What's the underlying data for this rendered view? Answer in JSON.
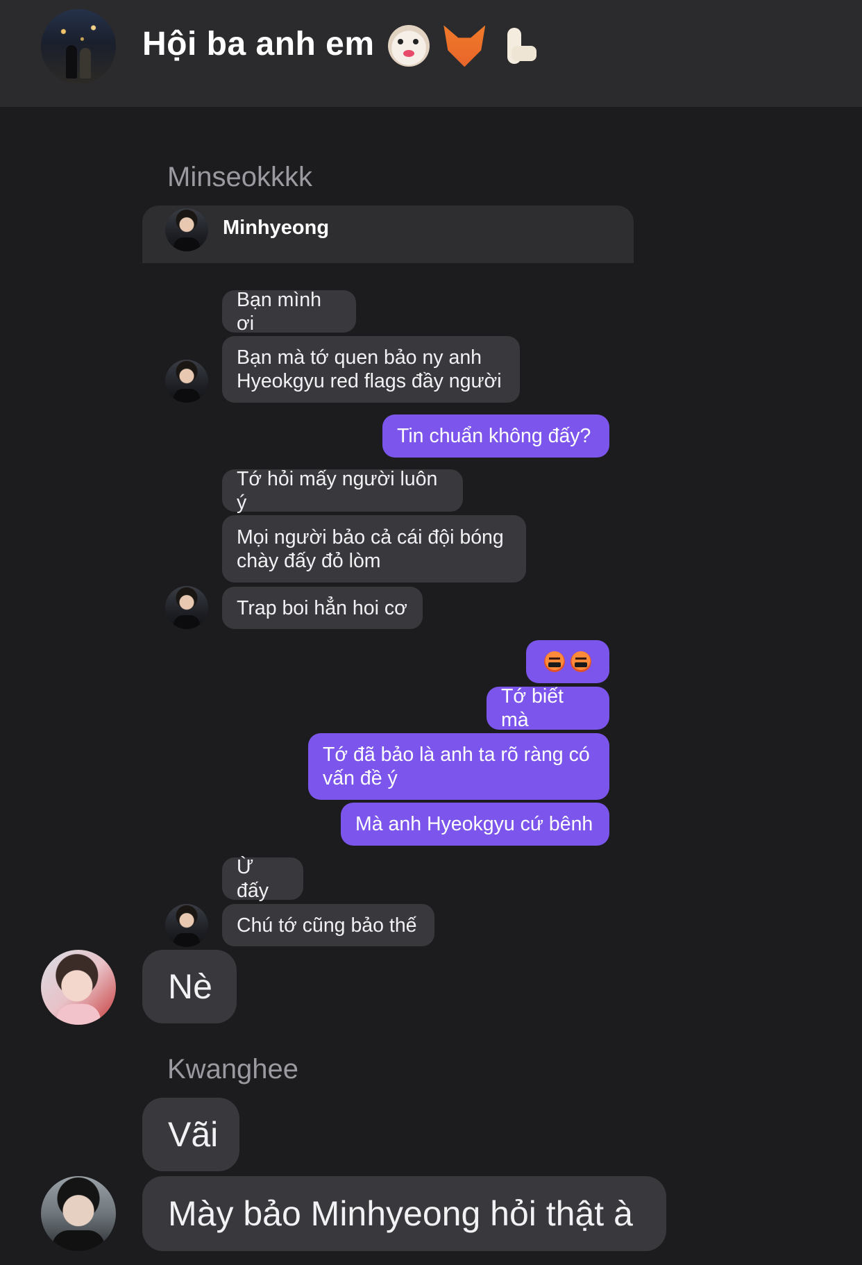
{
  "header": {
    "title": "Hội ba anh em",
    "emoji_icons": [
      "dog-face-emoji",
      "fox-face-emoji",
      "llama-emoji"
    ]
  },
  "chat": {
    "sender_minseok": "Minseokkkk",
    "quoted_name": "Minhyeong",
    "messages": {
      "m1": "Bạn mình ơi",
      "m2": "Bạn mà tớ quen bảo ny anh\nHyeokgyu red flags đầy người",
      "m3": "Tin chuẩn không đấy?",
      "m4": "Tớ hỏi mấy người luôn ý",
      "m5": "Mọi người bảo cả cái đội bóng\nchày đấy đỏ lòm",
      "m6": "Trap boi hẳn hoi cơ",
      "m7_icons": [
        "censored-swearing-face-emoji",
        "censored-swearing-face-emoji"
      ],
      "m8": "Tớ biết mà",
      "m9": "Tớ đã bảo là anh ta rõ ràng có\nvấn đề ý",
      "m10": "Mà anh Hyeokgyu cứ bênh",
      "m11": "Ừ đấy",
      "m12": "Chú tớ cũng bảo thế",
      "m13": "Nè"
    },
    "sender_kwanghee": "Kwanghee",
    "messages2": {
      "m14": "Vãi",
      "m15": "Mày bảo Minhyeong hỏi thật à"
    }
  },
  "colors": {
    "background": "#1c1c1e",
    "header": "#2b2b2d",
    "incoming_bubble": "#39393d",
    "outgoing_bubble": "#7b55ec"
  }
}
